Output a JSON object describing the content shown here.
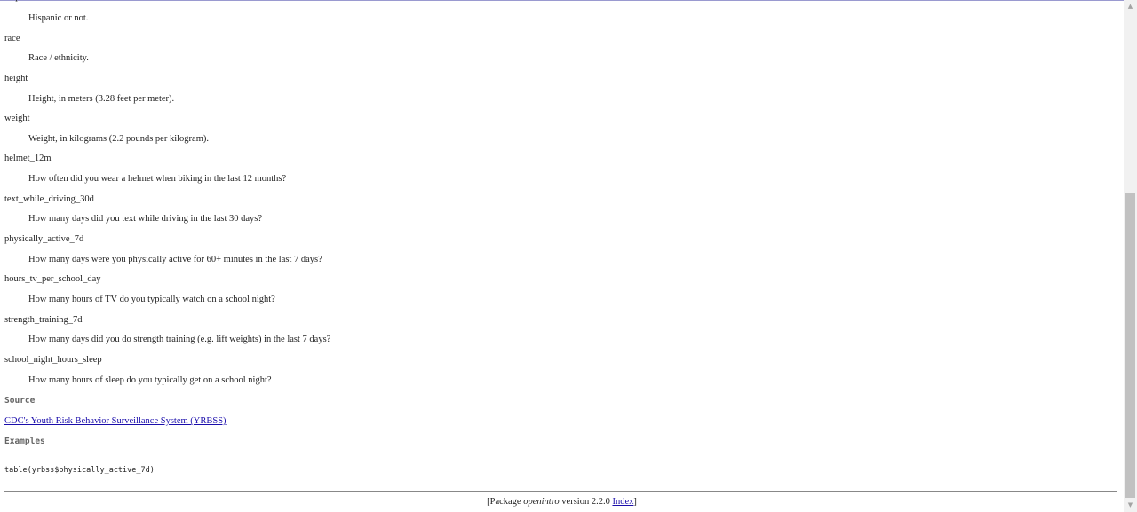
{
  "definitions": {
    "partial_term": "hispanic",
    "items": [
      {
        "desc": "Hispanic or not."
      },
      {
        "term": "race",
        "desc": "Race / ethnicity."
      },
      {
        "term": "height",
        "desc": "Height, in meters (3.28 feet per meter)."
      },
      {
        "term": "weight",
        "desc": "Weight, in kilograms (2.2 pounds per kilogram)."
      },
      {
        "term": "helmet_12m",
        "desc": "How often did you wear a helmet when biking in the last 12 months?"
      },
      {
        "term": "text_while_driving_30d",
        "desc": "How many days did you text while driving in the last 30 days?"
      },
      {
        "term": "physically_active_7d",
        "desc": "How many days were you physically active for 60+ minutes in the last 7 days?"
      },
      {
        "term": "hours_tv_per_school_day",
        "desc": "How many hours of TV do you typically watch on a school night?"
      },
      {
        "term": "strength_training_7d",
        "desc": "How many days did you do strength training (e.g. lift weights) in the last 7 days?"
      },
      {
        "term": "school_night_hours_sleep",
        "desc": "How many hours of sleep do you typically get on a school night?"
      }
    ]
  },
  "source": {
    "heading": "Source",
    "link_text": "CDC's Youth Risk Behavior Surveillance System (YRBSS)"
  },
  "examples": {
    "heading": "Examples",
    "code": "table(yrbss$physically_active_7d)"
  },
  "footer": {
    "prefix": "[Package ",
    "package_name": "openintro",
    "version_text": " version 2.2.0 ",
    "index_link": "Index",
    "suffix": "]"
  },
  "scrollbar": {
    "up_arrow_icon": "triangle-up-icon",
    "down_arrow_icon": "triangle-down-icon"
  }
}
